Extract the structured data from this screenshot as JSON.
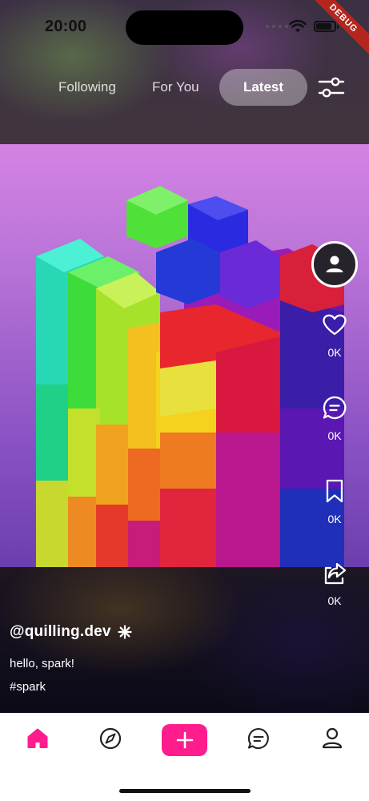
{
  "status_bar": {
    "time": "20:00",
    "debug_label": "DEBUG"
  },
  "tabs": [
    {
      "label": "Following",
      "active": false
    },
    {
      "label": "For You",
      "active": false
    },
    {
      "label": "Latest",
      "active": true
    }
  ],
  "actions": {
    "like": {
      "icon": "heart-icon",
      "count": "0K"
    },
    "comment": {
      "icon": "comment-icon",
      "count": "0K"
    },
    "save": {
      "icon": "bookmark-icon",
      "count": "0K"
    },
    "share": {
      "icon": "share-icon",
      "count": "0K"
    }
  },
  "post": {
    "username": "@quilling.dev",
    "description": "hello, spark!",
    "hashtag": "#spark"
  },
  "bottom_nav": [
    {
      "name": "home",
      "icon": "home-icon",
      "active": true
    },
    {
      "name": "explore",
      "icon": "compass-icon",
      "active": false
    },
    {
      "name": "create",
      "icon": "plus-icon",
      "active": false
    },
    {
      "name": "messages",
      "icon": "chat-icon",
      "active": false
    },
    {
      "name": "profile",
      "icon": "user-icon",
      "active": false
    }
  ],
  "colors": {
    "accent": "#ff1c8d",
    "debug": "#b3261e"
  }
}
